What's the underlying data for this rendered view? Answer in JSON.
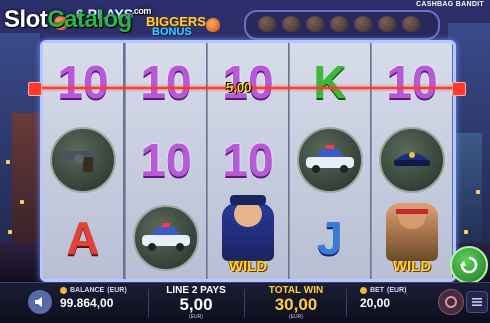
{
  "site_logo": {
    "part1": "Slot",
    "part2": "Catalog",
    "suffix": ".com"
  },
  "game_title": {
    "line1": "6 PLAYS",
    "line2": "BIGGERS",
    "line3": "BONUS"
  },
  "brand": "CASHBAG BANDIT",
  "reels": [
    [
      "10",
      "gun",
      "A"
    ],
    [
      "10",
      "10",
      "police-car"
    ],
    [
      "10",
      "10",
      "police-officer-wild"
    ],
    [
      "K",
      "police-car",
      "J"
    ],
    [
      "10",
      "police-hat",
      "bandit-wild"
    ]
  ],
  "wild_label": "WILD",
  "win_on_line": "5,00",
  "bottom_bar": {
    "balance_label": "BALANCE",
    "balance_unit": "(EUR)",
    "balance_value": "99.864,00",
    "line_pays_title": "LINE 2 PAYS",
    "line_pays_value": "5,00",
    "line_pays_unit": "(EUR)",
    "total_win_title": "TOTAL WIN",
    "total_win_value": "30,00",
    "total_win_unit": "(EUR)",
    "bet_label": "BET",
    "bet_unit": "(EUR)",
    "bet_value": "20,00"
  },
  "colors": {
    "payline": "#ff3a2a",
    "symbol_ten": "#b85ad8",
    "symbol_k": "#3eb83a",
    "symbol_a": "#e0423a",
    "symbol_j": "#3a7ad8",
    "gold": "#ffcf3a"
  },
  "icons": [
    "money-bag-icon",
    "sound-icon",
    "coin-icon",
    "spin-icon",
    "autoplay-icon",
    "menu-icon"
  ]
}
